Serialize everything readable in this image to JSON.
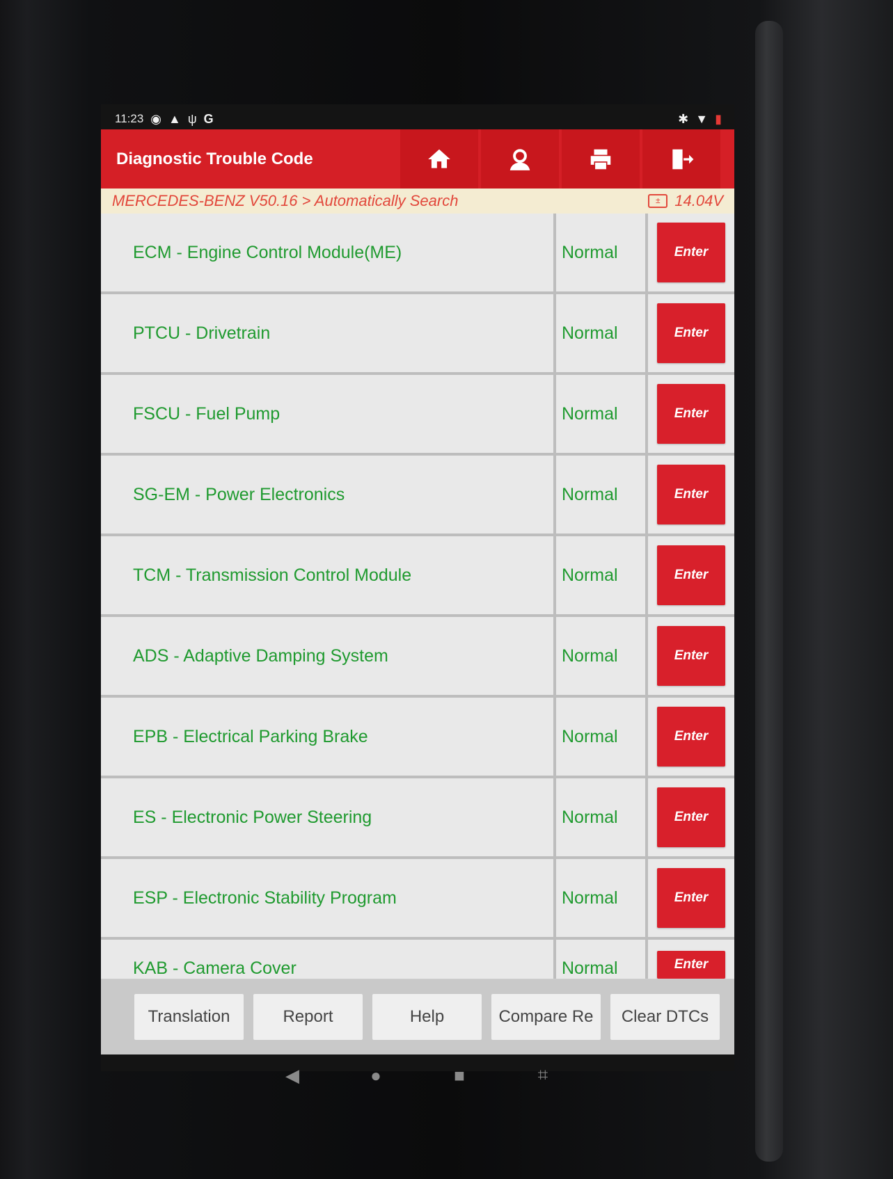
{
  "status_bar": {
    "time": "11:23",
    "left_icons": [
      "alarm-icon",
      "warning-icon",
      "usb-icon",
      "google-icon"
    ],
    "right_icons": [
      "bluetooth-icon",
      "wifi-icon",
      "battery-icon"
    ]
  },
  "header": {
    "title": "Diagnostic Trouble Code",
    "tools": [
      "home-icon",
      "user-icon",
      "print-icon",
      "exit-icon"
    ]
  },
  "breadcrumb": {
    "path": "MERCEDES-BENZ V50.16 > Automatically Search",
    "voltage": "14.04V"
  },
  "modules": [
    {
      "name": "ECM - Engine Control Module(ME)",
      "status": "Normal",
      "action": "Enter"
    },
    {
      "name": "PTCU - Drivetrain",
      "status": "Normal",
      "action": "Enter"
    },
    {
      "name": "FSCU - Fuel Pump",
      "status": "Normal",
      "action": "Enter"
    },
    {
      "name": "SG-EM - Power Electronics",
      "status": "Normal",
      "action": "Enter"
    },
    {
      "name": "TCM - Transmission Control Module",
      "status": "Normal",
      "action": "Enter"
    },
    {
      "name": "ADS - Adaptive Damping System",
      "status": "Normal",
      "action": "Enter"
    },
    {
      "name": "EPB - Electrical Parking Brake",
      "status": "Normal",
      "action": "Enter"
    },
    {
      "name": "ES - Electronic Power Steering",
      "status": "Normal",
      "action": "Enter"
    },
    {
      "name": "ESP - Electronic Stability Program",
      "status": "Normal",
      "action": "Enter"
    },
    {
      "name": "KAB - Camera Cover",
      "status": "Normal",
      "action": "Enter"
    }
  ],
  "bottom_bar": {
    "buttons": [
      "Translation",
      "Report",
      "Help",
      "Compare Re",
      "Clear DTCs"
    ]
  },
  "nav_bar": {
    "icons": [
      "back-icon",
      "home-circle-icon",
      "recents-icon",
      "screenshot-icon"
    ]
  },
  "colors": {
    "header_red": "#d51f26",
    "enter_red": "#d8202b",
    "text_green": "#1f9a2f",
    "breadcrumb_text": "#e2473b"
  }
}
